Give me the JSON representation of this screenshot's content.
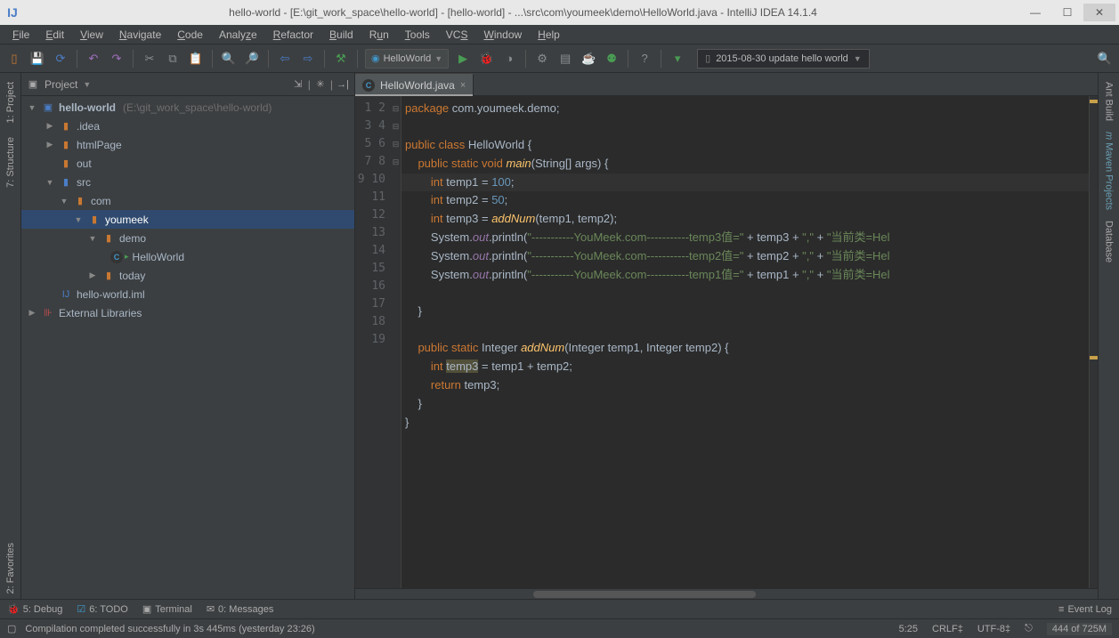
{
  "window": {
    "title": "hello-world - [E:\\git_work_space\\hello-world] - [hello-world] - ...\\src\\com\\youmeek\\demo\\HelloWorld.java - IntelliJ IDEA 14.1.4"
  },
  "menu": [
    "File",
    "Edit",
    "View",
    "Navigate",
    "Code",
    "Analyze",
    "Refactor",
    "Build",
    "Run",
    "Tools",
    "VCS",
    "Window",
    "Help"
  ],
  "toolbar": {
    "run_config": "HelloWorld",
    "vcs_message": "2015-08-30 update hello world"
  },
  "project_panel": {
    "title": "Project",
    "root": "hello-world",
    "root_path": "(E:\\git_work_space\\hello-world)",
    "nodes": [
      {
        "name": ".idea"
      },
      {
        "name": "htmlPage"
      },
      {
        "name": "out"
      },
      {
        "name": "src"
      },
      {
        "name": "com"
      },
      {
        "name": "youmeek"
      },
      {
        "name": "demo"
      },
      {
        "name": "HelloWorld"
      },
      {
        "name": "today"
      },
      {
        "name": "hello-world.iml"
      },
      {
        "name": "External Libraries"
      }
    ]
  },
  "editor": {
    "tab": "HelloWorld.java",
    "lines": [
      "1",
      "2",
      "3",
      "4",
      "5",
      "6",
      "7",
      "8",
      "9",
      "10",
      "11",
      "12",
      "13",
      "14",
      "15",
      "16",
      "17",
      "18",
      "19"
    ]
  },
  "left_tabs": [
    "1: Project",
    "7: Structure",
    "2: Favorites"
  ],
  "right_tabs": [
    "Ant Build",
    "Maven Projects",
    "Database"
  ],
  "bottom_tools": {
    "debug": "5: Debug",
    "todo": "6: TODO",
    "terminal": "Terminal",
    "messages": "0: Messages",
    "event_log": "Event Log"
  },
  "status": {
    "msg": "Compilation completed successfully in 3s 445ms (yesterday 23:26)",
    "pos": "5:25",
    "crlf": "CRLF‡",
    "enc": "UTF-8‡",
    "readonly": "⎋",
    "mem": "444 of 725M"
  },
  "code": {
    "l1a": "package ",
    "l1b": "com.youmeek.demo;",
    "l3a": "public class ",
    "l3b": "HelloWorld {",
    "l4a": "    public static ",
    "l4b": "void ",
    "l4c": "main",
    "l4d": "(String[] args) {",
    "l5a": "        int ",
    "l5b": "temp1 = ",
    "l5c": "100",
    "l5d": ";",
    "l6a": "        int ",
    "l6b": "temp2 = ",
    "l6c": "50",
    "l6d": ";",
    "l7a": "        int ",
    "l7b": "temp3 = ",
    "l7c": "addNum",
    "l7d": "(temp1, temp2);",
    "l8a": "        System.",
    "l8b": "out",
    "l8c": ".println(",
    "l8d": "\"-----------YouMeek.com-----------temp3值=\"",
    "l8e": " + temp3 + ",
    "l8f": "\",\"",
    "l8g": " + ",
    "l8h": "\"当前类=Hel",
    "l9d": "\"-----------YouMeek.com-----------temp2值=\"",
    "l9e": " + temp2 + ",
    "l10d": "\"-----------YouMeek.com-----------temp1值=\"",
    "l10e": " + temp1 + ",
    "l12": "    }",
    "l14a": "    public static ",
    "l14b": "Integer ",
    "l14c": "addNum",
    "l14d": "(Integer temp1, Integer temp2) {",
    "l15a": "        int ",
    "l15b": "temp3",
    "l15c": " = temp1 + temp2;",
    "l16a": "        return ",
    "l16b": "temp3;",
    "l17": "    }",
    "l18": "}"
  }
}
